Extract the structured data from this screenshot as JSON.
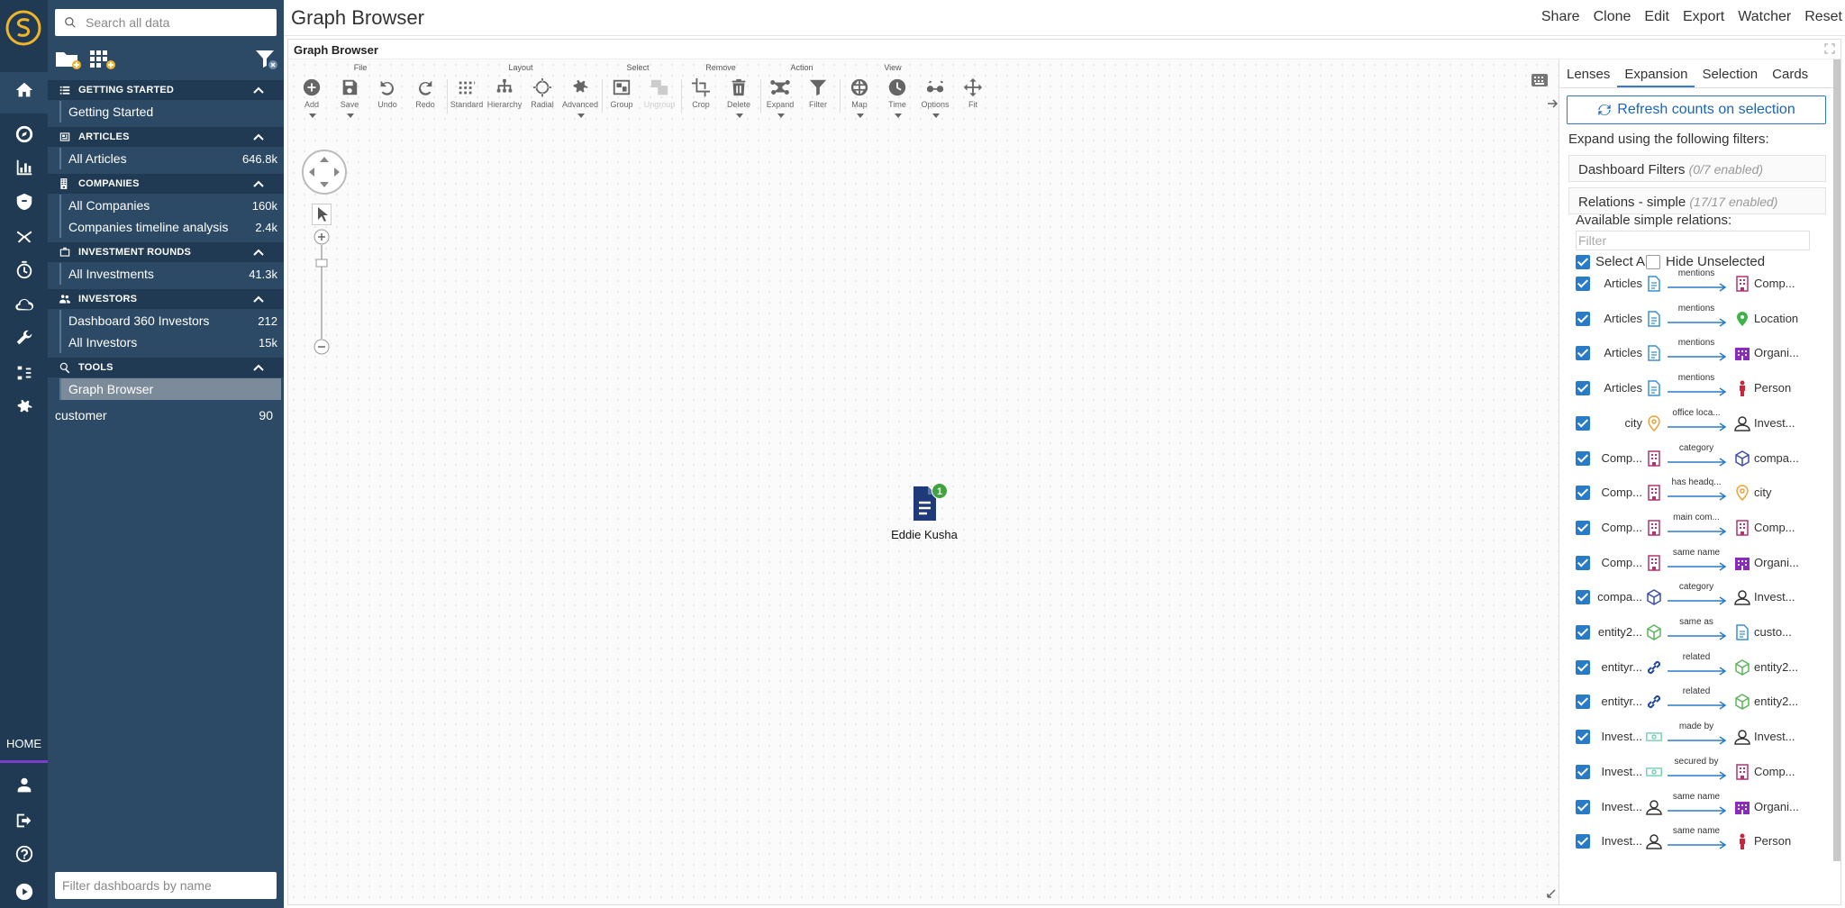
{
  "app": {
    "page_title": "Graph Browser",
    "panel_title": "Graph Browser"
  },
  "topmenu": [
    "Share",
    "Clone",
    "Edit",
    "Export",
    "Watcher",
    "Reset"
  ],
  "rail": {
    "home_label": "HOME"
  },
  "sidebar": {
    "search_placeholder": "Search all data",
    "filter_placeholder": "Filter dashboards by name",
    "sections": [
      {
        "title": "GETTING STARTED",
        "items": [
          {
            "label": "Getting Started",
            "count": ""
          }
        ]
      },
      {
        "title": "ARTICLES",
        "items": [
          {
            "label": "All Articles",
            "count": "646.8k"
          }
        ]
      },
      {
        "title": "COMPANIES",
        "items": [
          {
            "label": "All Companies",
            "count": "160k"
          },
          {
            "label": "Companies timeline analysis",
            "count": "2.4k"
          }
        ]
      },
      {
        "title": "INVESTMENT ROUNDS",
        "items": [
          {
            "label": "All Investments",
            "count": "41.3k"
          }
        ]
      },
      {
        "title": "INVESTORS",
        "items": [
          {
            "label": "Dashboard 360 Investors",
            "count": "212"
          },
          {
            "label": "All Investors",
            "count": "15k"
          }
        ]
      },
      {
        "title": "TOOLS",
        "items": [
          {
            "label": "Graph Browser",
            "count": ""
          }
        ]
      }
    ],
    "loose_item": {
      "label": "customer",
      "count": "90"
    }
  },
  "toolbar": {
    "groups": [
      "File",
      "Layout",
      "Select",
      "Remove",
      "Action",
      "View"
    ],
    "buttons": [
      "Add",
      "Save",
      "Undo",
      "Redo",
      "Standard",
      "Hierarchy",
      "Radial",
      "Advanced",
      "Group",
      "Ungroup",
      "Crop",
      "Delete",
      "Expand",
      "Filter",
      "Map",
      "Time",
      "Options",
      "Fit"
    ]
  },
  "graph": {
    "node_label": "Eddie Kusha",
    "node_badge": "1",
    "node_icon": "document-icon"
  },
  "right_panel": {
    "tabs": [
      "Lenses",
      "Expansion",
      "Selection",
      "Cards"
    ],
    "active_tab": "Expansion",
    "refresh_label": "Refresh counts on selection",
    "expand_label": "Expand using the following filters:",
    "dashboard_filters": "Dashboard Filters",
    "dashboard_filters_state": "(0/7 enabled)",
    "relations_simple": "Relations - simple",
    "relations_simple_state": "(17/17 enabled)",
    "available_label": "Available simple relations:",
    "filter_placeholder": "Filter",
    "select_all": "Select All",
    "hide_unselected": "Hide Unselected",
    "relations": [
      {
        "src": "Articles",
        "src_icon": "document-icon",
        "label": "mentions",
        "tgt": "Comp...",
        "tgt_icon": "building-icon"
      },
      {
        "src": "Articles",
        "src_icon": "document-icon",
        "label": "mentions",
        "tgt": "Location",
        "tgt_icon": "location-icon"
      },
      {
        "src": "Articles",
        "src_icon": "document-icon",
        "label": "mentions",
        "tgt": "Organi...",
        "tgt_icon": "organization-icon"
      },
      {
        "src": "Articles",
        "src_icon": "document-icon",
        "label": "mentions",
        "tgt": "Person",
        "tgt_icon": "person-icon"
      },
      {
        "src": "city",
        "src_icon": "pin-icon",
        "label": "office loca...",
        "tgt": "Invest...",
        "tgt_icon": "user-icon"
      },
      {
        "src": "Comp...",
        "src_icon": "building-icon",
        "label": "category",
        "tgt": "compa...",
        "tgt_icon": "cube-icon"
      },
      {
        "src": "Comp...",
        "src_icon": "building-icon",
        "label": "has headq...",
        "tgt": "city",
        "tgt_icon": "pin-icon"
      },
      {
        "src": "Comp...",
        "src_icon": "building-icon",
        "label": "main com...",
        "tgt": "Comp...",
        "tgt_icon": "building-icon"
      },
      {
        "src": "Comp...",
        "src_icon": "building-icon",
        "label": "same name",
        "tgt": "Organi...",
        "tgt_icon": "organization-icon"
      },
      {
        "src": "compa...",
        "src_icon": "cube-icon",
        "label": "category",
        "tgt": "Invest...",
        "tgt_icon": "user-icon"
      },
      {
        "src": "entity2...",
        "src_icon": "green-cube-icon",
        "label": "same as",
        "tgt": "custo...",
        "tgt_icon": "document-icon"
      },
      {
        "src": "entityr...",
        "src_icon": "link-icon",
        "label": "related",
        "tgt": "entity2...",
        "tgt_icon": "green-cube-icon"
      },
      {
        "src": "entityr...",
        "src_icon": "link-icon",
        "label": "related",
        "tgt": "entity2...",
        "tgt_icon": "green-cube-icon"
      },
      {
        "src": "Invest...",
        "src_icon": "money-icon",
        "label": "made by",
        "tgt": "Invest...",
        "tgt_icon": "user-icon"
      },
      {
        "src": "Invest...",
        "src_icon": "money-icon",
        "label": "secured by",
        "tgt": "Comp...",
        "tgt_icon": "building-icon"
      },
      {
        "src": "Invest...",
        "src_icon": "user-icon",
        "label": "same name",
        "tgt": "Organi...",
        "tgt_icon": "organization-icon"
      },
      {
        "src": "Invest...",
        "src_icon": "user-icon",
        "label": "same name",
        "tgt": "Person",
        "tgt_icon": "person-icon"
      }
    ]
  },
  "colors": {
    "rail": "#1f3a52",
    "sidebar": "#2c4a65",
    "accent": "#2a7bc7",
    "node": "#1e3a7a",
    "badge": "#3fa33f",
    "purple": "#7b3ec9"
  }
}
